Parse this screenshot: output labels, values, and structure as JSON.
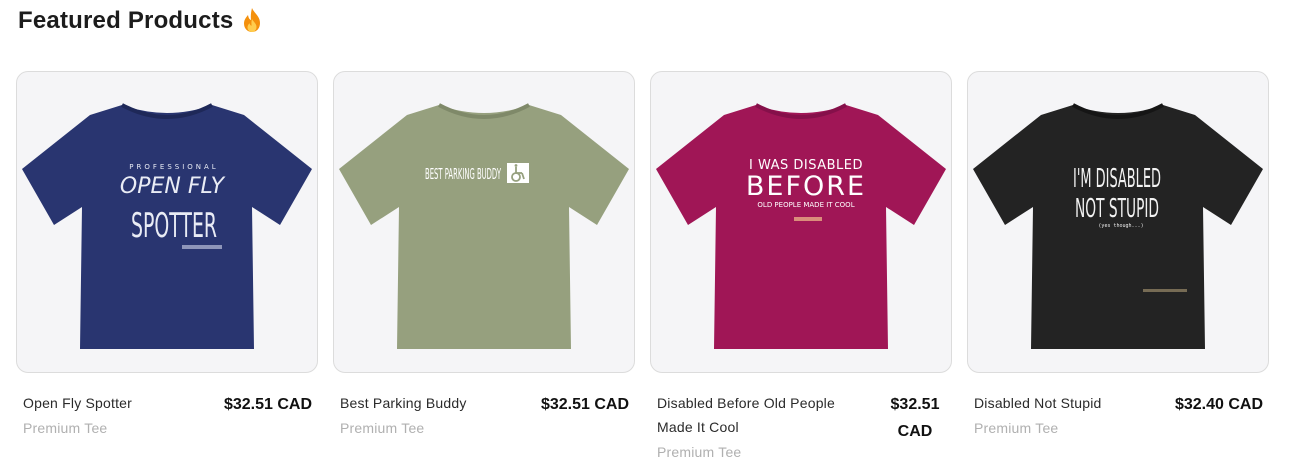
{
  "section": {
    "title": "Featured Products",
    "icon": "fire-icon"
  },
  "colors": {
    "card_bg": "#f5f5f7",
    "shirt_navy": "#293570",
    "shirt_sage": "#96a07e",
    "shirt_berry": "#a01656",
    "shirt_black": "#232323"
  },
  "products": [
    {
      "name": "Open Fly Spotter",
      "type": "Premium Tee",
      "price": "$32.51 CAD",
      "design_lines": [
        "PROFESSIONAL",
        "OPEN FLY",
        "SPOTTER"
      ]
    },
    {
      "name": "Best Parking Buddy",
      "type": "Premium Tee",
      "price": "$32.51 CAD",
      "design_lines": [
        "BEST PARKING BUDDY"
      ]
    },
    {
      "name": "Disabled Before Old People Made It Cool",
      "type": "Premium Tee",
      "price": "$32.51 CAD",
      "design_lines": [
        "I WAS DISABLED",
        "BEFORE",
        "OLD PEOPLE MADE IT COOL"
      ]
    },
    {
      "name": "Disabled Not Stupid",
      "type": "Premium Tee",
      "price": "$32.40 CAD",
      "design_lines": [
        "I'M DISABLED",
        "NOT STUPID",
        "(yes though...)"
      ]
    }
  ]
}
